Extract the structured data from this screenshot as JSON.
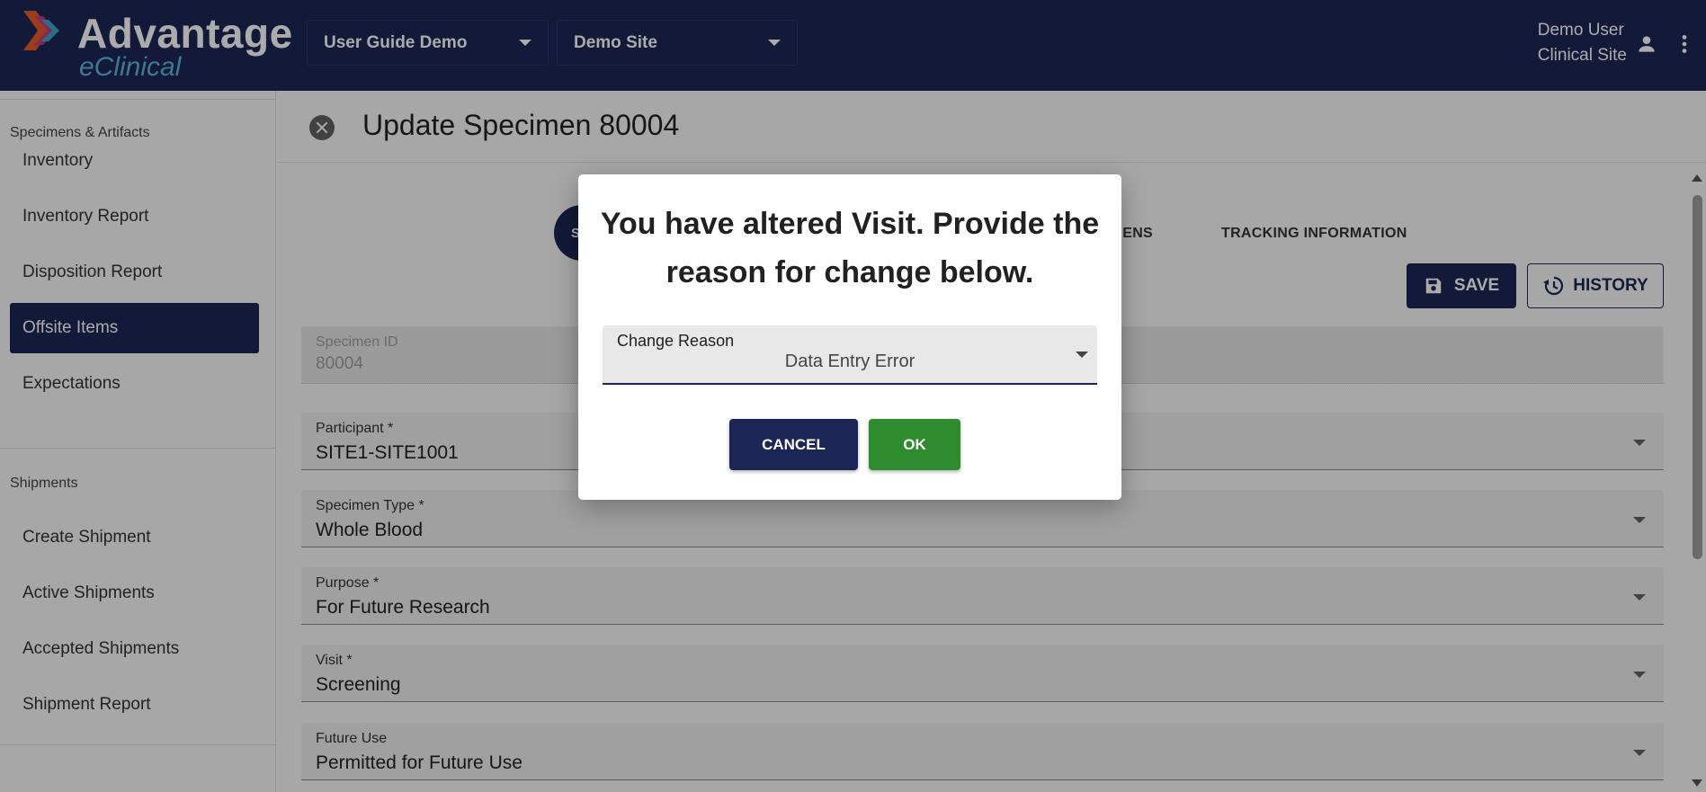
{
  "header": {
    "logo_title": "Advantage",
    "logo_subtitle": "eClinical",
    "study_select": "User Guide Demo",
    "site_select": "Demo Site",
    "user_name": "Demo User",
    "user_site": "Clinical Site",
    "user_icon": "person-icon",
    "menu_icon": "more-vert-icon"
  },
  "sidebar": {
    "section1": "Specimens & Artifacts",
    "section1_items": [
      {
        "label": "Inventory"
      },
      {
        "label": "Inventory Report"
      },
      {
        "label": "Disposition Report"
      },
      {
        "label": "Offsite Items",
        "active": true
      },
      {
        "label": "Expectations"
      }
    ],
    "section2": "Shipments",
    "section2_items": [
      {
        "label": "Create Shipment"
      },
      {
        "label": "Active Shipments"
      },
      {
        "label": "Accepted Shipments"
      },
      {
        "label": "Shipment Report"
      }
    ]
  },
  "main": {
    "title": "Update Specimen 80004",
    "step_text": "S",
    "tabs": [
      "CIMENS",
      "TRACKING INFORMATION"
    ],
    "save_label": "SAVE",
    "history_label": "HISTORY",
    "fields": [
      {
        "label": "Specimen ID",
        "value": "80004",
        "disabled": true
      },
      {
        "label": "Participant *",
        "value": "SITE1-SITE1001"
      },
      {
        "label": "Specimen Type *",
        "value": "Whole Blood"
      },
      {
        "label": "Purpose *",
        "value": "For Future Research"
      },
      {
        "label": "Visit *",
        "value": "Screening"
      },
      {
        "label": "Future Use",
        "value": "Permitted for Future Use"
      }
    ]
  },
  "dialog": {
    "message": "You have altered Visit. Provide the reason for change below.",
    "reason_label": "Change Reason",
    "reason_value": "Data Entry Error",
    "cancel_label": "CANCEL",
    "ok_label": "OK"
  },
  "colors": {
    "primary": "#1b2656",
    "accent_green": "#2e8b2e",
    "logo_blue": "#5fb4d8"
  }
}
